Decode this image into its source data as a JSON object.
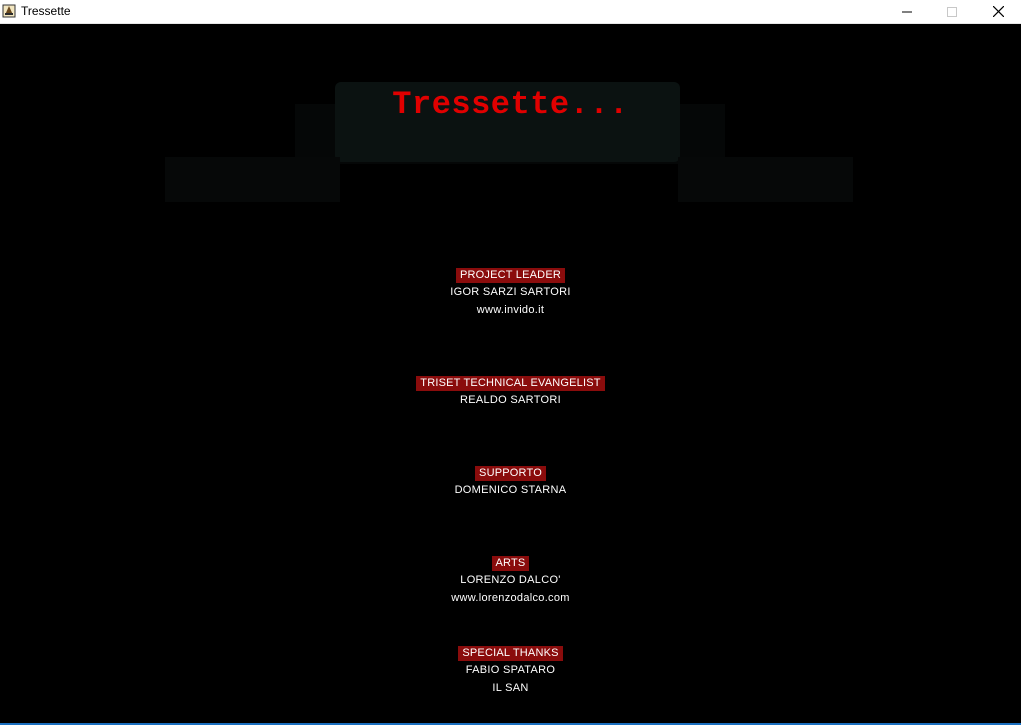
{
  "window": {
    "title": "Tressette",
    "icon": "card-app-icon",
    "controls": {
      "minimize": "minimize-icon",
      "maximize": "maximize-icon",
      "close": "close-icon"
    }
  },
  "screen": {
    "heading": "Tressette...",
    "credits": [
      {
        "role": "PROJECT LEADER",
        "lines": [
          "IGOR SARZI SARTORI",
          "www.invido.it"
        ]
      },
      {
        "role": "TRISET TECHNICAL EVANGELIST",
        "lines": [
          "REALDO SARTORI"
        ]
      },
      {
        "role": "SUPPORTO",
        "lines": [
          "DOMENICO STARNA"
        ]
      },
      {
        "role": "ARTS",
        "lines": [
          "LORENZO DALCO'",
          "www.lorenzodalco.com"
        ]
      },
      {
        "role": "SPECIAL THANKS",
        "lines": [
          "FABIO SPATARO",
          "IL SAN"
        ]
      }
    ]
  },
  "colors": {
    "background": "#000000",
    "heading": "#e00000",
    "role_badge": "#8a0c0c",
    "text": "#ffffff"
  }
}
